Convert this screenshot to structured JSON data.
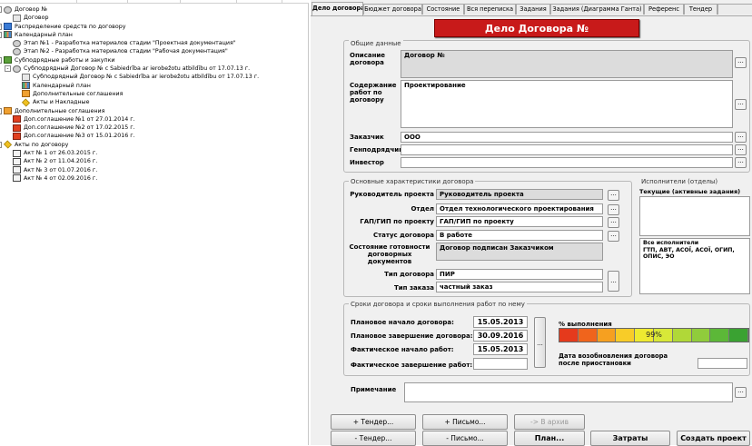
{
  "tree": [
    {
      "label": "Договор №",
      "level": 0,
      "icon": "doc-stack-icon",
      "exp": "-"
    },
    {
      "label": "Договор",
      "level": 1,
      "icon": "document-icon",
      "exp": ""
    },
    {
      "label": "Распределение средств по договору",
      "level": 0,
      "icon": "money-icon",
      "exp": "+"
    },
    {
      "label": "Календарный план",
      "level": 0,
      "icon": "calendar-icon",
      "exp": "-"
    },
    {
      "label": "Этап №1 - Разработка материалов стадии \"Проектная документация\"",
      "level": 1,
      "icon": "stage-icon",
      "exp": ""
    },
    {
      "label": "Этап №2 - Разработка материалов стадии \"Рабочая документация\"",
      "level": 1,
      "icon": "stage-icon",
      "exp": ""
    },
    {
      "label": "Субподрядные работы и закупки",
      "level": 0,
      "icon": "subcontract-icon",
      "exp": "-"
    },
    {
      "label": "Субподрядный Договор №    с Sabiedrība ar ierobežotu atbildību    от 17.07.13 г.",
      "level": 1,
      "icon": "gear-icon",
      "exp": "-"
    },
    {
      "label": "Субподрядный Договор №    с Sabiedrība ar ierobežotu atbildību    от 17.07.13 г.",
      "level": 2,
      "icon": "document-icon",
      "exp": ""
    },
    {
      "label": "Календарный план",
      "level": 2,
      "icon": "calendar-icon",
      "exp": ""
    },
    {
      "label": "Дополнительные соглашения",
      "level": 2,
      "icon": "agreement-icon",
      "exp": ""
    },
    {
      "label": "Акты и Накладные",
      "level": 2,
      "icon": "acts-icon",
      "exp": ""
    },
    {
      "label": "Дополнительные соглашения",
      "level": 0,
      "icon": "agreement-icon",
      "exp": "-"
    },
    {
      "label": "Доп.соглашение №1 от 27.01.2014 г.",
      "level": 1,
      "icon": "red-doc-icon",
      "exp": ""
    },
    {
      "label": "Доп.соглашение №2 от 17.02.2015 г.",
      "level": 1,
      "icon": "red-doc-icon",
      "exp": ""
    },
    {
      "label": "Доп.соглашение №3 от 15.01.2016 г.",
      "level": 1,
      "icon": "red-doc-icon",
      "exp": ""
    },
    {
      "label": "Акты по договору",
      "level": 0,
      "icon": "acts-icon",
      "exp": "-"
    },
    {
      "label": "Акт № 1 от 26.03.2015 г.",
      "level": 1,
      "icon": "act-icon",
      "exp": ""
    },
    {
      "label": "Акт № 2 от 11.04.2016 г.",
      "level": 1,
      "icon": "act-icon",
      "exp": ""
    },
    {
      "label": "Акт № 3 от 01.07.2016 г.",
      "level": 1,
      "icon": "act-icon",
      "exp": ""
    },
    {
      "label": "Акт № 4 от 02.09.2016 г.",
      "level": 1,
      "icon": "act-icon",
      "exp": ""
    }
  ],
  "tabs": [
    {
      "label": "Дело договора",
      "active": true
    },
    {
      "label": "Бюджет договора",
      "active": false
    },
    {
      "label": "Состояние",
      "active": false
    },
    {
      "label": "Вся переписка",
      "active": false
    },
    {
      "label": "Задания",
      "active": false
    },
    {
      "label": "Задания (Диаграмма Ганта)",
      "active": false
    },
    {
      "label": "Референс",
      "active": false
    },
    {
      "label": "Тендер",
      "active": false
    }
  ],
  "banner": "Дело Договора №",
  "general": {
    "title": "Общие данные",
    "desc_label": "Описание договора",
    "desc_value": "Договор №",
    "content_label": "Содержание работ по договору",
    "content_value": "Проектирование",
    "customer_label": "Заказчик",
    "customer_value": "ООО",
    "gencontractor_label": "Генподрядчик",
    "gencontractor_value": "",
    "investor_label": "Инвестор",
    "investor_value": ""
  },
  "main_chars": {
    "title": "Основные характеристики договора",
    "pm_label": "Руководитель проекта",
    "pm_value": "Руководитель проекта",
    "dept_label": "Отдел",
    "dept_value": "Отдел технологического проектирования",
    "gap_label": "ГАП/ГИП по проекту",
    "gap_value": "ГАП/ГИП по проекту",
    "status_label": "Статус договора",
    "status_value": "В работе",
    "readiness_label": "Состояние готовности договорных документов",
    "readiness_value": "Договор подписан Заказчиком",
    "type_label": "Тип договора",
    "type_value": "ПИР",
    "order_label": "Тип заказа",
    "order_value": "частный заказ"
  },
  "executors": {
    "title": "Исполнители (отделы)",
    "current_label": "Текущие (активные задания)",
    "all_label": "Все исполнители",
    "all_value": "ГТП, АВТ, АСОЇ, АСОЇ, ОГИП, ОПИС, ЭО"
  },
  "terms": {
    "title": "Сроки договора и сроки выполнения работ по нему",
    "plan_start_label": "Плановое начало договора:",
    "plan_start_value": "15.05.2013",
    "plan_end_label": "Плановое завершение договора:",
    "plan_end_value": "30.09.2016",
    "fact_start_label": "Фактическое начало работ:",
    "fact_start_value": "15.05.2013",
    "fact_end_label": "Фактическое завершение работ:",
    "fact_end_value": "",
    "percent_label": "% выполнения",
    "percent_value": "99%",
    "percent_fraction": 0.99,
    "resume_label": "Дата возобновления договора после приостановки",
    "resume_value": ""
  },
  "note_label": "Примечание",
  "note_value": "",
  "buttons": {
    "add_tender": "+ Тендер...",
    "add_letter": "+ Письмо...",
    "to_archive": "-> В архив",
    "remove_tender": "- Тендер...",
    "remove_letter": "- Письмо...",
    "plan": "План...",
    "costs": "Затраты",
    "create_project": "Создать проект",
    "dots": "..."
  },
  "colors": {
    "banner": "#c81a1a",
    "progress_segments": [
      "#e53a1c",
      "#f0641c",
      "#f6a020",
      "#f8cc28",
      "#eeea30",
      "#d8e838",
      "#b0d838",
      "#90cc3c",
      "#5cb838",
      "#3aa232"
    ]
  }
}
